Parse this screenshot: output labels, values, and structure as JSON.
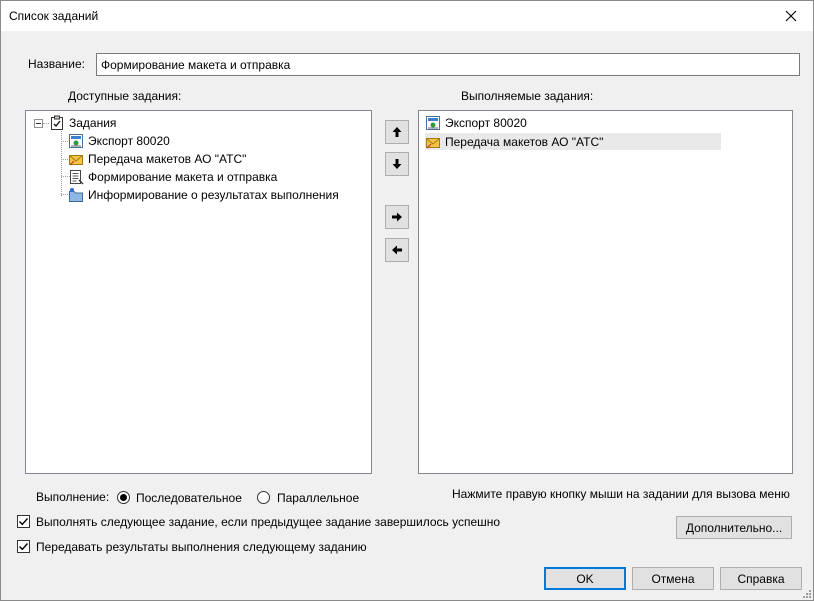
{
  "window": {
    "title": "Список заданий"
  },
  "name_field": {
    "label": "Название:",
    "value": "Формирование макета и отправка"
  },
  "available": {
    "label": "Доступные задания:",
    "root": "Задания",
    "items": [
      {
        "label": "Экспорт 80020",
        "icon": "export-icon"
      },
      {
        "label": "Передача макетов АО \"АТС\"",
        "icon": "envelope-icon"
      },
      {
        "label": "Формирование макета и отправка",
        "icon": "document-form-icon"
      },
      {
        "label": "Информирование о результатах выполнения",
        "icon": "folder-info-icon"
      }
    ]
  },
  "executed": {
    "label": "Выполняемые задания:",
    "items": [
      {
        "label": "Экспорт 80020",
        "icon": "export-icon"
      },
      {
        "label": "Передача макетов АО \"АТС\"",
        "icon": "envelope-icon",
        "selected": true
      }
    ]
  },
  "arrows": [
    "move-up",
    "move-down",
    "add-right",
    "remove-left"
  ],
  "execution": {
    "label": "Выполнение:",
    "options": [
      {
        "label": "Последовательное",
        "checked": true
      },
      {
        "label": "Параллельное",
        "checked": false
      }
    ]
  },
  "hint": "Нажмите правую кнопку мыши на задании для вызова меню",
  "checkboxes": [
    {
      "label": "Выполнять следующее задание, если предыдущее задание завершилось успешно",
      "checked": true
    },
    {
      "label": "Передавать результаты выполнения следующему заданию",
      "checked": true
    }
  ],
  "buttons": {
    "advanced": "Дополнительно...",
    "ok": "OK",
    "cancel": "Отмена",
    "help": "Справка"
  }
}
